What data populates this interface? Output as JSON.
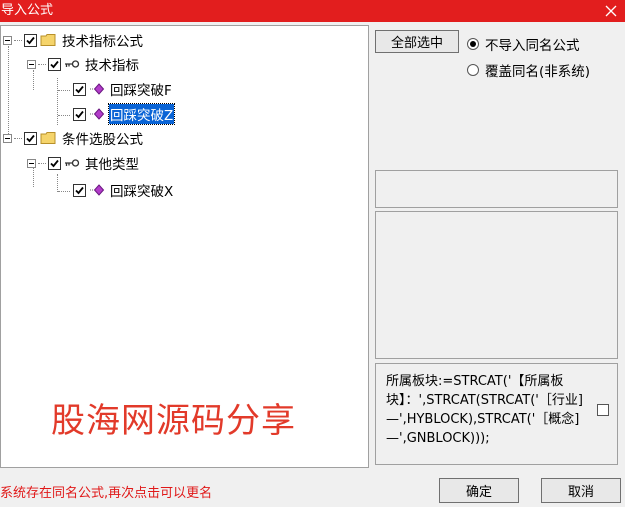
{
  "window": {
    "title": "导入公式"
  },
  "tree": {
    "nodes": [
      {
        "label": "技术指标公式",
        "type": "folder"
      },
      {
        "label": "技术指标",
        "type": "key"
      },
      {
        "label": "回踩突破F",
        "type": "formula"
      },
      {
        "label": "回踩突破Z",
        "type": "formula",
        "selected": true
      },
      {
        "label": "条件选股公式",
        "type": "folder"
      },
      {
        "label": "其他类型",
        "type": "key"
      },
      {
        "label": "回踩突破X",
        "type": "formula"
      }
    ]
  },
  "buttons": {
    "select_all": "全部选中",
    "ok": "确定",
    "cancel": "取消"
  },
  "options": {
    "no_import_same_name": "不导入同名公式",
    "overwrite_same_name": "覆盖同名(非系统)",
    "selected": "no_import_same_name"
  },
  "formula_text": "所属板块:=STRCAT('【所属板块】：',STRCAT(STRCAT('［行业]—',HYBLOCK),STRCAT('［概念]—',GNBLOCK)));",
  "watermark": "股海网源码分享",
  "status_message": "系统存在同名公式,再次点击可以更名",
  "colors": {
    "titlebar": "#e21e1e",
    "selection": "#0a64d6",
    "status_text": "#e01818",
    "watermark": "#e23a2a"
  }
}
